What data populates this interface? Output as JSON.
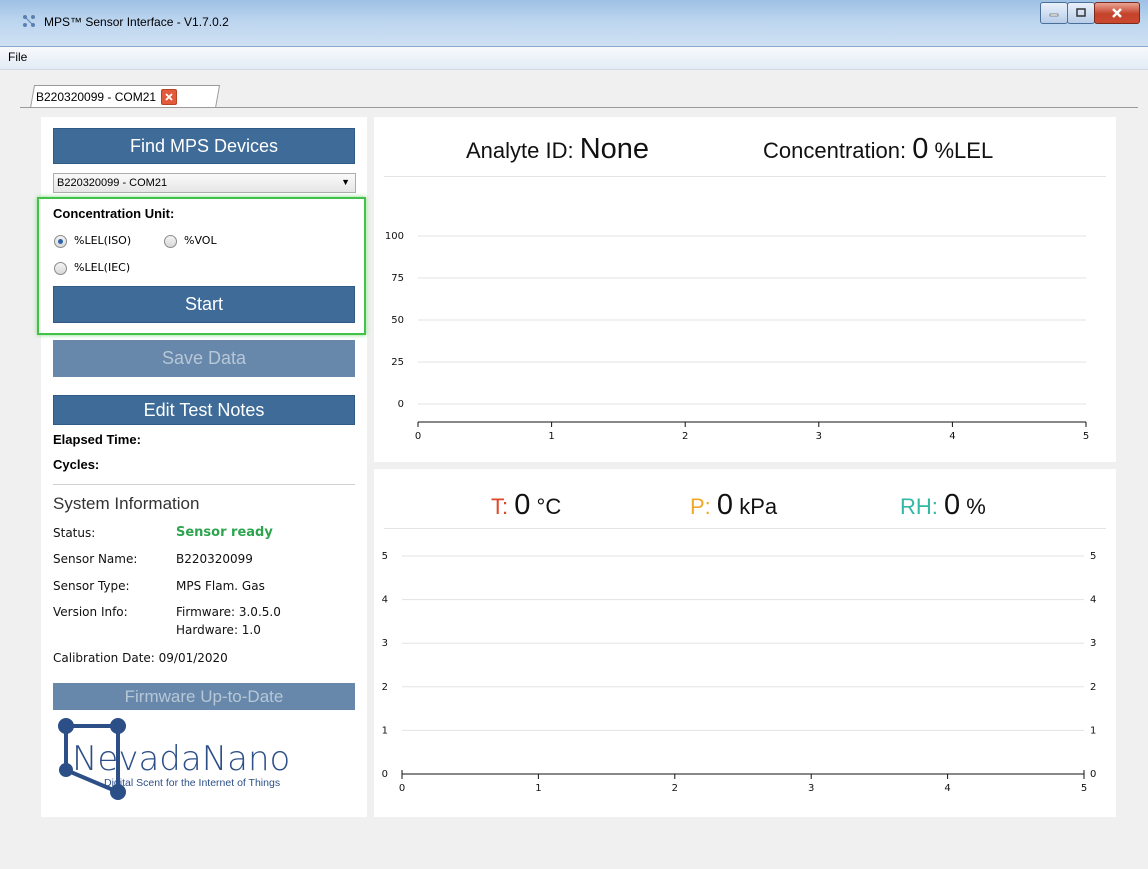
{
  "window": {
    "title": "MPS™ Sensor Interface - V1.7.0.2"
  },
  "menu": {
    "file": "File"
  },
  "tab": {
    "label": "B220320099 - COM21"
  },
  "left": {
    "find_button": "Find MPS Devices",
    "device_select": "B220320099 - COM21",
    "conc_unit_label": "Concentration Unit:",
    "units": [
      {
        "label": "%LEL(ISO)",
        "checked": true
      },
      {
        "label": "%VOL",
        "checked": false
      },
      {
        "label": "%LEL(IEC)",
        "checked": false
      }
    ],
    "start_button": "Start",
    "save_button": "Save Data",
    "notes_button": "Edit Test Notes",
    "elapsed_label": "Elapsed Time:",
    "cycles_label": "Cycles:",
    "system_info_title": "System Information",
    "status_key": "Status:",
    "status_value": "Sensor ready",
    "sensor_name_key": "Sensor Name:",
    "sensor_name_value": "B220320099",
    "sensor_type_key": "Sensor Type:",
    "sensor_type_value": "MPS Flam. Gas",
    "version_key": "Version Info:",
    "firmware_value": "Firmware: 3.0.5.0",
    "hardware_value": "Hardware: 1.0",
    "calibration": "Calibration Date: 09/01/2020",
    "firmware_button": "Firmware Up-to-Date",
    "logo_text": "NevadaNano",
    "logo_tagline": "Digital Scent for the Internet of Things"
  },
  "top_chart": {
    "analyte_label": "Analyte ID:",
    "analyte_value": "None",
    "conc_label": "Concentration:",
    "conc_value": "0",
    "conc_unit": "%LEL"
  },
  "bottom_chart": {
    "t_label": "T:",
    "t_value": "0",
    "t_unit": "°C",
    "p_label": "P:",
    "p_value": "0",
    "p_unit": "kPa",
    "rh_label": "RH:",
    "rh_value": "0",
    "rh_unit": "%"
  },
  "colors": {
    "button_blue": "#3e6b98",
    "t_color": "#e0472a",
    "p_color": "#f0a92a",
    "rh_color": "#34b8a6",
    "status_green": "#2ea44f",
    "highlight_green": "#43c249"
  },
  "chart_data": [
    {
      "type": "line",
      "x_ticks": [
        "0",
        "1",
        "2",
        "3",
        "4",
        "5"
      ],
      "y_ticks": [
        "0",
        "25",
        "50",
        "75",
        "100"
      ],
      "xlim": [
        0,
        5
      ],
      "ylim": [
        0,
        100
      ],
      "series": [],
      "grid": true
    },
    {
      "type": "line",
      "x_ticks": [
        "0",
        "1",
        "2",
        "3",
        "4",
        "5"
      ],
      "y_ticks": [
        "0",
        "1",
        "2",
        "3",
        "4",
        "5"
      ],
      "y2_ticks": [
        "0",
        "1",
        "2",
        "3",
        "4",
        "5"
      ],
      "xlim": [
        0,
        5
      ],
      "ylim": [
        0,
        5
      ],
      "series": [],
      "grid": true
    }
  ]
}
